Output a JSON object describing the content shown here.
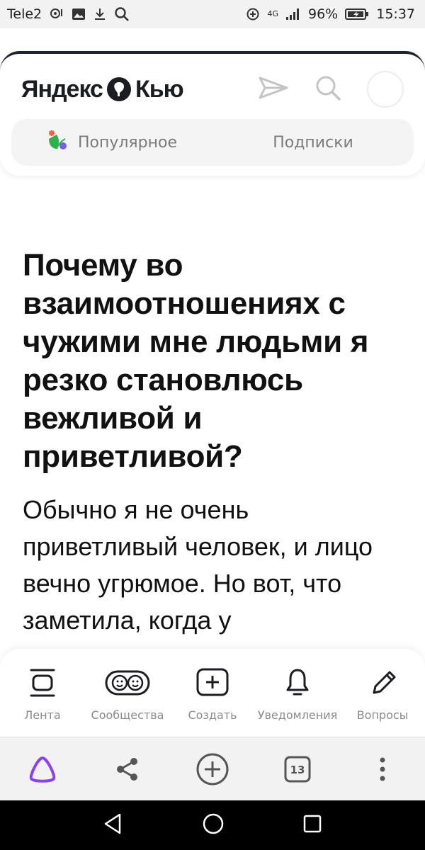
{
  "status_bar": {
    "carrier": "Tele2",
    "network": "4G",
    "battery": "96%",
    "time": "15:37"
  },
  "header": {
    "logo_left": "Яндекс",
    "logo_right": "Кью",
    "icons": [
      "send-icon",
      "search-icon",
      "avatar"
    ]
  },
  "tabs": [
    {
      "label": "Популярное",
      "icon": "popular-icon"
    },
    {
      "label": "Подписки"
    }
  ],
  "article": {
    "title": "Почему во взаимоотношениях с чужими мне людьми я резко становлюсь вежливой и приветливой?",
    "body": "Обычно я не очень приветливый человек, и лицо вечно угрюмое. Но вот, что заметила, когда у"
  },
  "bottom_nav": [
    {
      "label": "Лента",
      "icon": "feed-icon"
    },
    {
      "label": "Сообщества",
      "icon": "communities-icon"
    },
    {
      "label": "Создать",
      "icon": "create-icon"
    },
    {
      "label": "Уведомления",
      "icon": "bell-icon"
    },
    {
      "label": "Вопросы",
      "icon": "pencil-icon"
    }
  ],
  "browser_bar": {
    "tabs_count": "13",
    "icons": [
      "alice-icon",
      "share-icon",
      "new-tab-icon",
      "tabs-icon",
      "more-icon"
    ]
  },
  "colors": {
    "brand_dark": "#1c1d21",
    "alice_purple": "#8b3ffd",
    "tab_bg": "#f4f4f4"
  }
}
